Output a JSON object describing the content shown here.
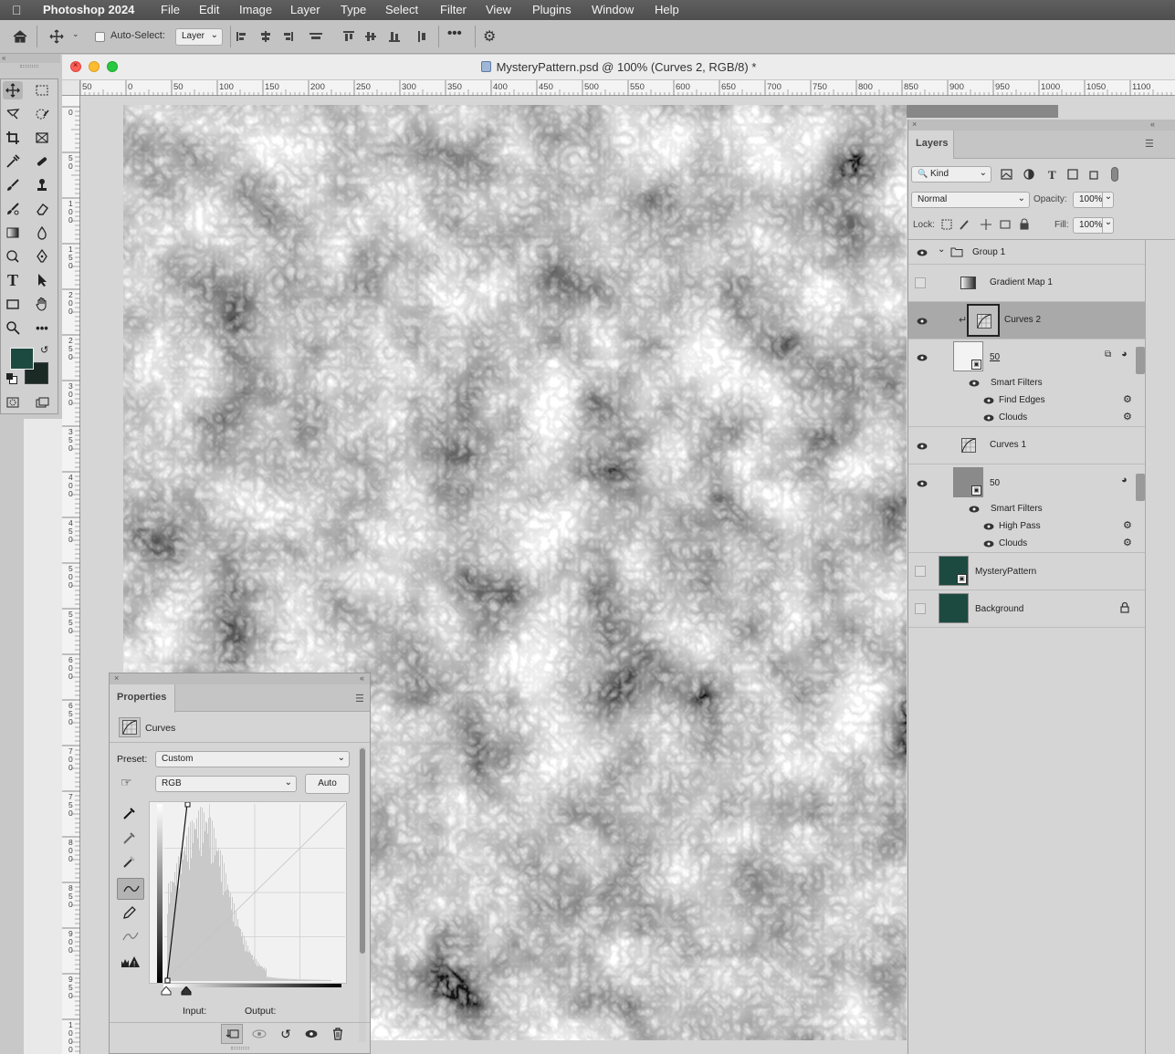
{
  "menubar": {
    "app_name": "Photoshop 2024",
    "items": [
      "File",
      "Edit",
      "Image",
      "Layer",
      "Type",
      "Select",
      "Filter",
      "View",
      "Plugins",
      "Window",
      "Help"
    ]
  },
  "optionsbar": {
    "auto_select_label": "Auto-Select:",
    "auto_select_checked": false,
    "auto_select_target": "Layer"
  },
  "document": {
    "title": "MysteryPattern.psd @ 100% (Curves 2, RGB/8) *",
    "ruler_h": [
      "50",
      "0",
      "50",
      "100",
      "150",
      "200",
      "250",
      "300",
      "350",
      "400",
      "450",
      "500",
      "550",
      "600",
      "650",
      "700",
      "750",
      "800",
      "850",
      "900",
      "950",
      "1000",
      "1050",
      "1100"
    ],
    "ruler_v": [
      "0",
      "50",
      "100",
      "150",
      "200",
      "250",
      "300",
      "350",
      "400",
      "450",
      "500",
      "550",
      "600",
      "650",
      "700",
      "750",
      "800",
      "850",
      "900",
      "950",
      "1000"
    ]
  },
  "colors": {
    "foreground": "#1d4a40",
    "background": "#1c2a26",
    "close": "#fe5f57",
    "minimize": "#febc2e",
    "zoom": "#28c840"
  },
  "layers": {
    "tab": "Layers",
    "filter_kind": "Kind",
    "blend_mode": "Normal",
    "opacity_label": "Opacity:",
    "opacity": "100%",
    "lock_label": "Lock:",
    "fill_label": "Fill:",
    "fill": "100%",
    "items": {
      "group": "Group 1",
      "gradient_map": "Gradient Map 1",
      "curves2": "Curves 2",
      "smart1": "50",
      "smart_filters1": "Smart Filters",
      "find_edges": "Find Edges",
      "clouds1": "Clouds",
      "curves1": "Curves 1",
      "smart2": "50",
      "smart_filters2": "Smart Filters",
      "high_pass": "High Pass",
      "clouds2": "Clouds",
      "mystery": "MysteryPattern",
      "background": "Background"
    }
  },
  "properties": {
    "tab": "Properties",
    "adjustment": "Curves",
    "preset_label": "Preset:",
    "preset": "Custom",
    "channel": "RGB",
    "auto_button": "Auto",
    "input_label": "Input:",
    "output_label": "Output:"
  }
}
